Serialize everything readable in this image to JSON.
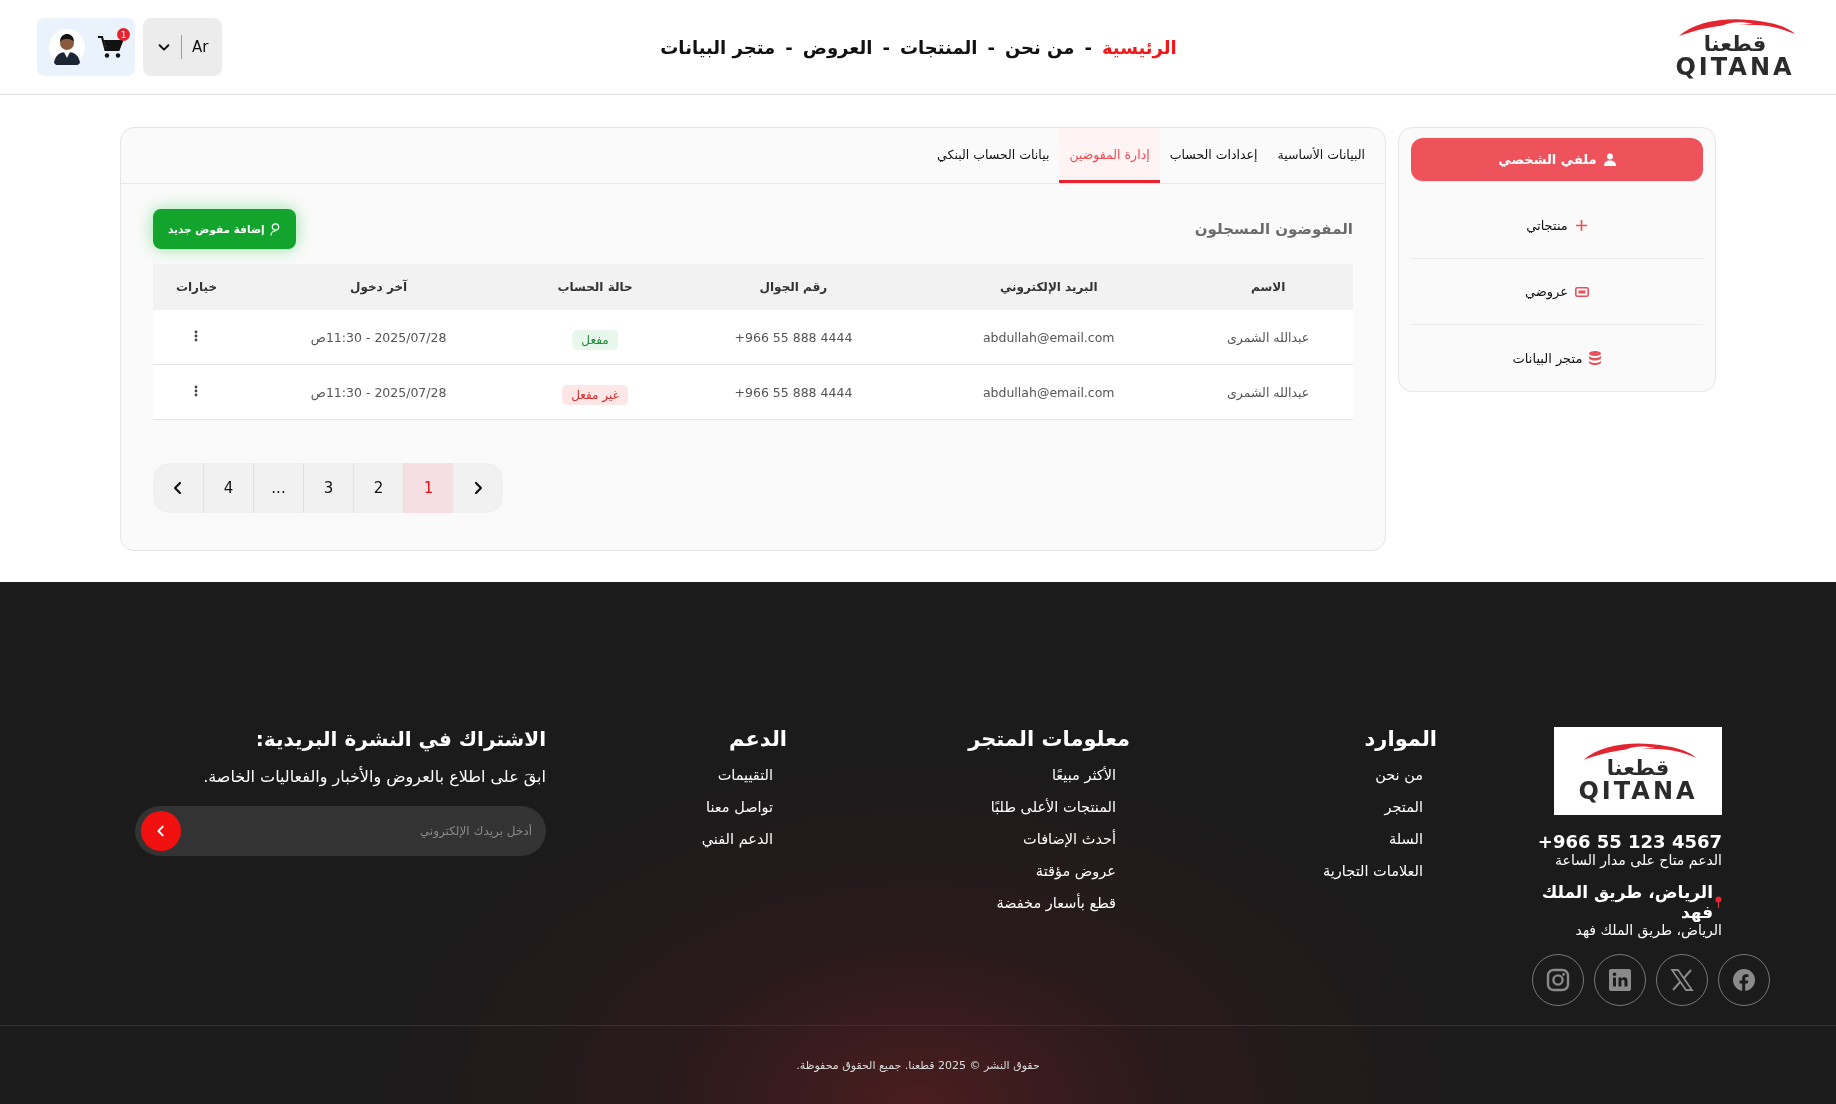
{
  "header": {
    "logo": {
      "arabic": "قطعنا",
      "latin": "QITANA"
    },
    "nav": [
      {
        "label": "الرئيسية",
        "selected": true
      },
      {
        "label": "من نحن",
        "selected": false
      },
      {
        "label": "المنتجات",
        "selected": false
      },
      {
        "label": "العروض",
        "selected": false
      },
      {
        "label": "متجر البيانات",
        "selected": false
      }
    ],
    "nav_separator": "-",
    "language": "Ar",
    "cart_count": "1"
  },
  "sidebar": {
    "items": [
      {
        "label": "ملفي الشخصي",
        "kind": "user",
        "selected": true
      },
      {
        "label": "منتجاتي",
        "kind": "plus",
        "selected": false
      },
      {
        "label": "عروضي",
        "kind": "ticket",
        "selected": false
      },
      {
        "label": "متجر البيانات",
        "kind": "database",
        "selected": false
      }
    ]
  },
  "tabs": [
    {
      "label": "البيانات الأساسية",
      "selected": false
    },
    {
      "label": "إعدادات الحساب",
      "selected": false
    },
    {
      "label": "إدارة المفوضين",
      "selected": true
    },
    {
      "label": "بيانات الحساب البنكي",
      "selected": false
    }
  ],
  "section_title": "المفوضون المسجلون",
  "add_button": "إضافة مفوض جديد",
  "table": {
    "columns": [
      "الاسم",
      "البريد الإلكتروني",
      "رقم الجوال",
      "حالة الحساب",
      "آخر دخول",
      "خيارات"
    ],
    "rows": [
      {
        "name": "عبدالله الشمرى",
        "email": "abdullah@email.com",
        "phone": "+966 55 888 4444",
        "status": {
          "label": "مفعل",
          "active": true
        },
        "last_login": "2025/07/28 - 11:30ص"
      },
      {
        "name": "عبدالله الشمرى",
        "email": "abdullah@email.com",
        "phone": "+966 55 888 4444",
        "status": {
          "label": "غير مفعل",
          "active": false
        },
        "last_login": "2025/07/28 - 11:30ص"
      }
    ]
  },
  "pagination": {
    "pages": [
      {
        "label": "1",
        "selected": true
      },
      {
        "label": "2",
        "selected": false
      },
      {
        "label": "3",
        "selected": false
      },
      {
        "label": "...",
        "selected": false
      },
      {
        "label": "4",
        "selected": false
      }
    ]
  },
  "footer": {
    "logo": {
      "arabic": "قطعنا",
      "latin": "QITANA"
    },
    "phone": "+966 55 123 4567",
    "support_hours": "الدعم متاح على مدار الساعة",
    "address_title": "الرياض، طريق الملك فهد",
    "address": "الرياض، طريق الملك فهد",
    "social": [
      {
        "kind": "facebook"
      },
      {
        "kind": "x"
      },
      {
        "kind": "linkedin"
      },
      {
        "kind": "instagram"
      }
    ],
    "columns": [
      {
        "title": "الموارد",
        "links": [
          "من نحن",
          "المتجر",
          "السلة",
          "العلامات التجارية"
        ]
      },
      {
        "title": "معلومات المتجر",
        "links": [
          "الأكثر مبيعًا",
          "المنتجات الأعلى طلبًا",
          "أحدث الإضافات",
          "عروض مؤقتة",
          "قطع بأسعار مخفضة"
        ]
      },
      {
        "title": "الدعم",
        "links": [
          "التقييمات",
          "تواصل معنا",
          "الدعم الفني"
        ]
      }
    ],
    "newsletter": {
      "title": "الاشتراك في النشرة البريدية:",
      "text": "ابقَ على اطلاع بالعروض والأخبار والفعاليات الخاصة.",
      "placeholder": "أدخل بريدك الإلكتروني"
    },
    "copyright": "حقوق النشر © 2025 قطعنا. جميع الحقوق محفوظة."
  }
}
